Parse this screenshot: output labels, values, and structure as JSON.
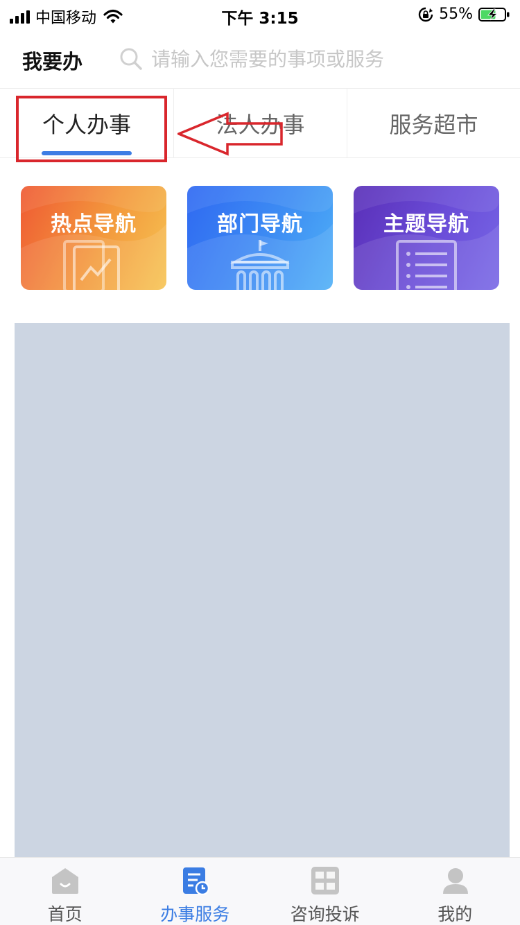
{
  "status_bar": {
    "carrier": "中国移动",
    "time": "下午 3:15",
    "battery": "55%"
  },
  "header": {
    "title": "我要办",
    "search_placeholder": "请输入您需要的事项或服务"
  },
  "tabs": [
    {
      "label": "个人办事",
      "active": true
    },
    {
      "label": "法人办事",
      "active": false
    },
    {
      "label": "服务超市",
      "active": false
    }
  ],
  "nav_cards": [
    {
      "label": "热点导航",
      "icon": "chart-document-icon"
    },
    {
      "label": "部门导航",
      "icon": "government-building-icon"
    },
    {
      "label": "主题导航",
      "icon": "list-document-icon"
    }
  ],
  "tabbar": {
    "items": [
      {
        "label": "首页",
        "icon": "home-icon",
        "active": false
      },
      {
        "label": "办事服务",
        "icon": "service-document-icon",
        "active": true
      },
      {
        "label": "咨询投诉",
        "icon": "people-hotline-icon",
        "active": false
      },
      {
        "label": "我的",
        "icon": "user-icon",
        "active": false
      }
    ]
  },
  "colors": {
    "accent": "#3d7de4",
    "annotation_red": "#d9262c",
    "placeholder_block": "#ccd5e2"
  }
}
